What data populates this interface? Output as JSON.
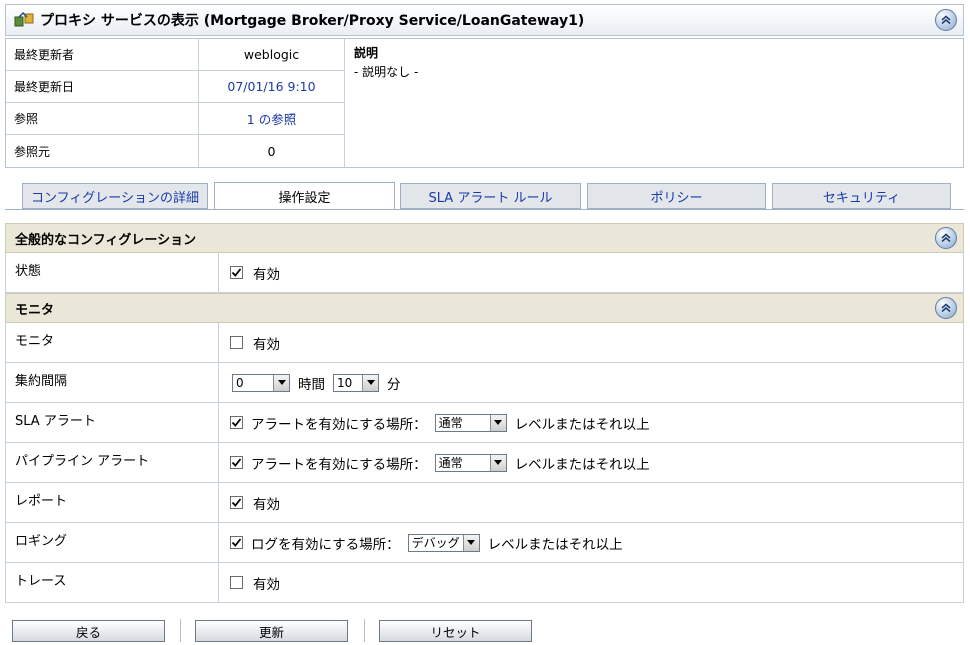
{
  "title": "プロキシ サービスの表示 (Mortgage Broker/Proxy Service/LoanGateway1)",
  "info": {
    "rows": [
      {
        "label": "最終更新者",
        "value": "weblogic"
      },
      {
        "label": "最終更新日",
        "value": "07/01/16 9:10"
      },
      {
        "label": "参照",
        "value": "1 の参照"
      },
      {
        "label": "参照元",
        "value": "0"
      }
    ],
    "description_title": "説明",
    "description_value": "- 説明なし -"
  },
  "tabs": [
    {
      "label": "コンフィグレーションの詳細",
      "active": false
    },
    {
      "label": "操作設定",
      "active": true
    },
    {
      "label": "SLA アラート ルール",
      "active": false
    },
    {
      "label": "ポリシー",
      "active": false
    },
    {
      "label": "セキュリティ",
      "active": false
    }
  ],
  "sections": {
    "general": {
      "title": "全般的なコンフィグレーション",
      "state_label": "状態",
      "state_enabled": true,
      "state_text": "有効"
    },
    "monitor": {
      "title": "モニタ",
      "monitor": {
        "label": "モニタ",
        "checked": false,
        "text": "有効"
      },
      "aggregation": {
        "label": "集約間隔",
        "hours_value": "0",
        "hours_unit": "時間",
        "minutes_value": "10",
        "minutes_unit": "分"
      },
      "sla_alert": {
        "label": "SLA アラート",
        "checked": true,
        "prefix": "アラートを有効にする場所：",
        "level": "通常",
        "suffix": "レベルまたはそれ以上"
      },
      "pipeline_alert": {
        "label": "パイプライン アラート",
        "checked": true,
        "prefix": "アラートを有効にする場所：",
        "level": "通常",
        "suffix": "レベルまたはそれ以上"
      },
      "report": {
        "label": "レポート",
        "checked": true,
        "text": "有効"
      },
      "logging": {
        "label": "ロギング",
        "checked": true,
        "prefix": "ログを有効にする場所：",
        "level": "デバッグ",
        "suffix": "レベルまたはそれ以上"
      },
      "trace": {
        "label": "トレース",
        "checked": false,
        "text": "有効"
      }
    }
  },
  "buttons": {
    "back": "戻る",
    "update": "更新",
    "reset": "リセット"
  },
  "icons": {
    "title": "proxy-service-icon",
    "collapse": "chevron-up-icon",
    "checkbox_checked": "check-icon",
    "select": "chevron-down-icon"
  },
  "colors": {
    "section_header_bg": "#ebe7d8",
    "link": "#1a3aa8",
    "tab_inactive_bg": "#e3e7ec"
  }
}
